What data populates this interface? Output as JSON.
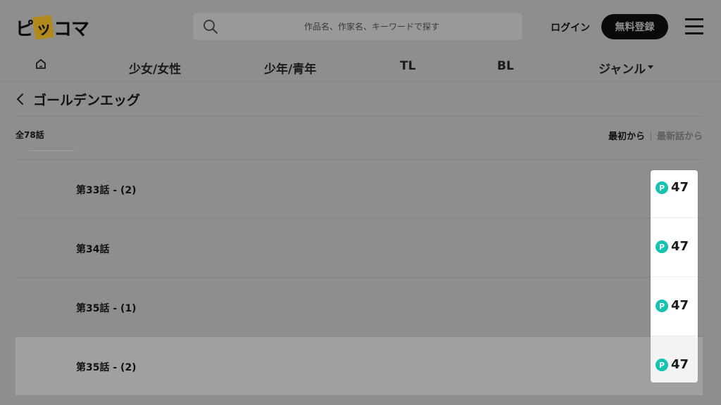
{
  "header": {
    "logo": {
      "before": "ピ",
      "tag": "ッ",
      "after": "コマ"
    },
    "search_placeholder": "作品名、作家名、キーワードで探す",
    "login_label": "ログイン",
    "register_label": "無料登録"
  },
  "nav": {
    "items": [
      {
        "label": "少女/女性"
      },
      {
        "label": "少年/青年"
      },
      {
        "label": "TL"
      },
      {
        "label": "BL"
      },
      {
        "label": "ジャンル"
      }
    ]
  },
  "title": "ゴールデンエッグ",
  "count_label": "全78話",
  "sort": {
    "first_label": "最初から",
    "latest_label": "最新話から"
  },
  "episodes": [
    {
      "title": "第33話 - (2)",
      "price_icon": "P",
      "price": "47"
    },
    {
      "title": "第34話",
      "price_icon": "P",
      "price": "47"
    },
    {
      "title": "第35話 - (1)",
      "price_icon": "P",
      "price": "47"
    },
    {
      "title": "第35話 - (2)",
      "price_icon": "P",
      "price": "47"
    }
  ],
  "colors": {
    "dim_background": "#8e8e8e",
    "point_badge": "#14c4b0",
    "register_button": "#0a0a0a"
  }
}
